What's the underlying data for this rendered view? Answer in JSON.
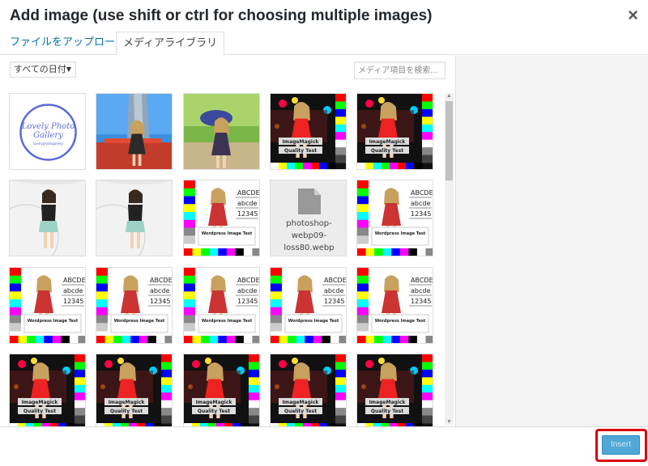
{
  "dialog": {
    "title": "Add image (use shift or ctrl for choosing multiple images)",
    "close_symbol": "×"
  },
  "tabs": [
    {
      "label": "ファイルをアップロード",
      "active": false
    },
    {
      "label": "メディアライブラリ",
      "active": true
    }
  ],
  "filters": {
    "date_selected": "すべての日付",
    "search_placeholder": "メディア項目を検索..."
  },
  "thumbs": {
    "logo_text_1": "Lovely Photo",
    "logo_text_2": "Gallery",
    "logo_subtext": "lovelyphotogallery",
    "imagemagick_line1": "ImageMagick",
    "imagemagick_line2": "Quality Test",
    "wp_abcde": "ABCDE",
    "wp_abcde_lower": "abcde",
    "wp_numbers": "12345",
    "wp_caption": "Wordpress Image Test",
    "file_name_line1": "photoshop-",
    "file_name_line2": "webp09-",
    "file_name_line3": "loss80.webp"
  },
  "footer": {
    "insert_label": "Insert"
  },
  "colors": {
    "accent": "#0073aa",
    "insert_button": "#4fa8d6",
    "highlight": "#d9000f"
  },
  "grid_layout": [
    [
      "logo",
      "photo_building",
      "photo_park",
      "imagemagick",
      "imagemagick"
    ],
    [
      "photo_studio",
      "photo_studio",
      "wp_test",
      "file_webp",
      "wp_test"
    ],
    [
      "wp_test",
      "wp_test",
      "wp_test",
      "wp_test",
      "wp_test"
    ],
    [
      "imagemagick",
      "imagemagick",
      "imagemagick",
      "imagemagick",
      "imagemagick"
    ]
  ]
}
